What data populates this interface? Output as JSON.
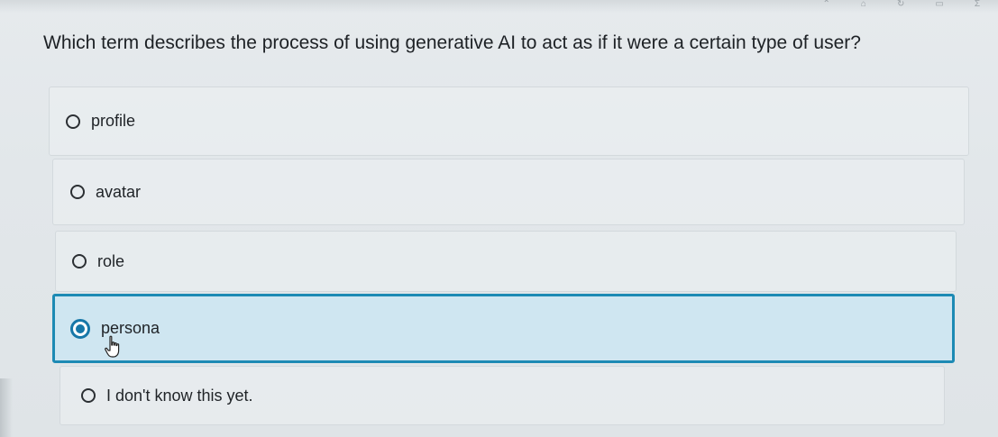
{
  "question": {
    "text": "Which term describes the process of using generative AI to act as if it were a certain type of user?"
  },
  "options": [
    {
      "label": "profile",
      "selected": false
    },
    {
      "label": "avatar",
      "selected": false
    },
    {
      "label": "role",
      "selected": false
    },
    {
      "label": "persona",
      "selected": true
    },
    {
      "label": "I don't know this yet.",
      "selected": false
    }
  ],
  "colors": {
    "accent": "#1d8ab4",
    "selected_background": "#cfe6f1",
    "page_background": "#e2e7ea"
  },
  "icons": {
    "cursor": "hand-pointer-icon"
  }
}
